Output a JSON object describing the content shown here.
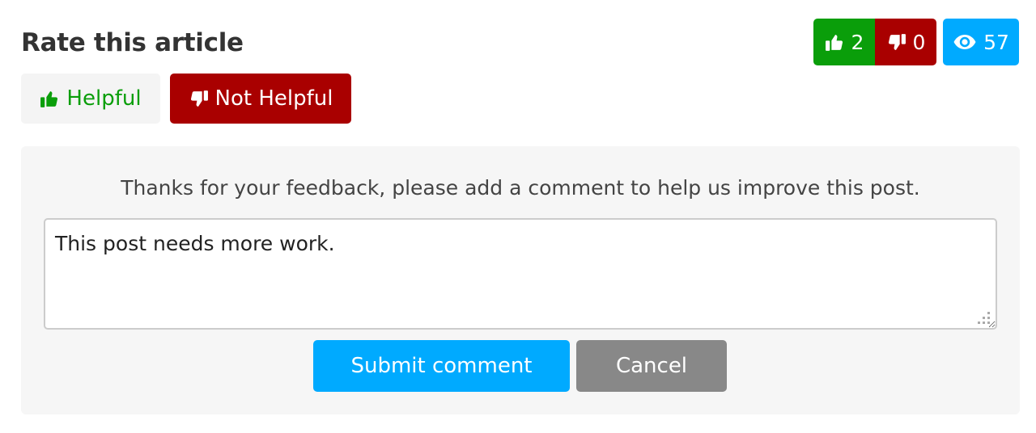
{
  "header": {
    "title": "Rate this article"
  },
  "stats": {
    "likes": "2",
    "dislikes": "0",
    "views": "57",
    "like_icon": "thumbs-up-icon",
    "dislike_icon": "thumbs-down-icon",
    "views_icon": "eye-icon"
  },
  "rating": {
    "helpful_label": "Helpful",
    "not_helpful_label": "Not Helpful",
    "selected": "Not Helpful"
  },
  "feedback": {
    "message": "Thanks for your feedback, please add a comment to help us improve this post.",
    "comment_value": "This post needs more work.",
    "submit_label": "Submit comment",
    "cancel_label": "Cancel"
  },
  "colors": {
    "green": "#0a9e0a",
    "red": "#a90000",
    "blue": "#00aaff",
    "gray": "#888888"
  }
}
